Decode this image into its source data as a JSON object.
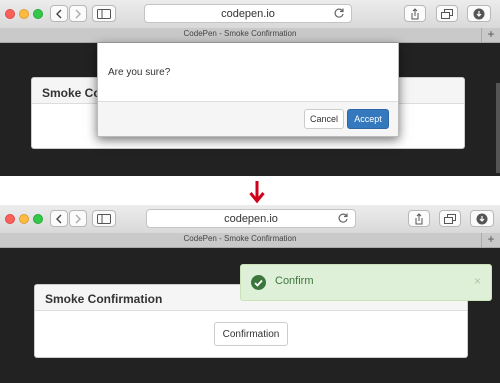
{
  "browser": {
    "url": "codepen.io",
    "tab_title": "CodePen - Smoke Confirmation",
    "new_tab_symbol": "+"
  },
  "page": {
    "panel_title_truncated": "Smoke Con",
    "panel_title": "Smoke Confirmation",
    "confirmation_button": "Confirmation"
  },
  "dialog": {
    "message": "Are you sure?",
    "cancel_label": "Cancel",
    "accept_label": "Accept"
  },
  "toast": {
    "message": "Confirm",
    "close_symbol": "×",
    "icon": "check-circle-icon"
  },
  "transition": {
    "arrow_icon": "down-arrow-icon",
    "arrow_color": "#d0021b"
  },
  "colors": {
    "accept_button": "#3479be",
    "toast_background": "#dff0d8",
    "toast_text": "#3c763d",
    "page_background": "#222222"
  }
}
